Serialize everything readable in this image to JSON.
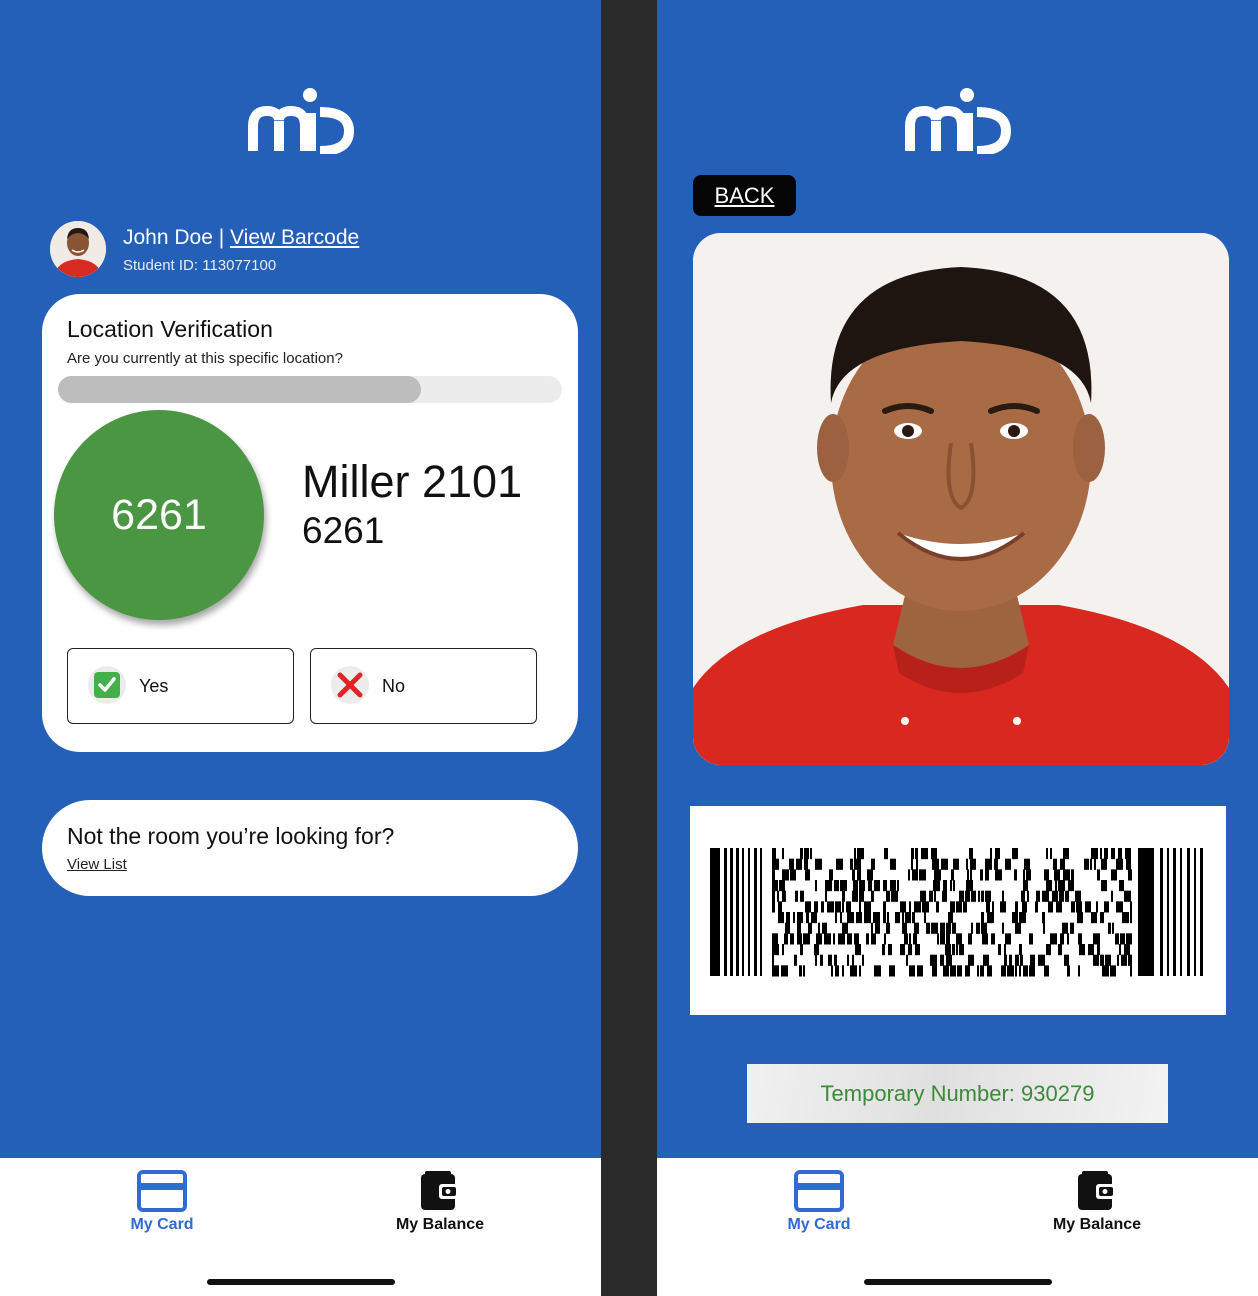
{
  "left_screen": {
    "profile": {
      "name": "John Doe",
      "separator": " | ",
      "view_barcode": "View Barcode",
      "student_id": "Student ID: 113077100"
    },
    "verification": {
      "title": "Location Verification",
      "subtitle": "Are you currently at this specific location?",
      "progress_fraction": 0.72,
      "code": "6261",
      "room_name": "Miller 2101",
      "room_number": "6261",
      "yes_label": "Yes",
      "no_label": "No"
    },
    "alternate": {
      "title": "Not the room you’re looking for?",
      "link": "View List"
    }
  },
  "right_screen": {
    "back_label": "BACK",
    "temporary_number": "Temporary Number: 930279"
  },
  "nav": {
    "card_label": "My Card",
    "balance_label": "My Balance"
  },
  "colors": {
    "background_blue": "#245fb8",
    "accent_blue": "#2f6bd0",
    "code_green": "#4a9642",
    "temp_text_green": "#3a8a38",
    "no_red": "#e02424"
  },
  "icons": [
    "mid-logo",
    "avatar",
    "check-icon",
    "x-icon",
    "card-icon",
    "wallet-icon",
    "barcode"
  ]
}
